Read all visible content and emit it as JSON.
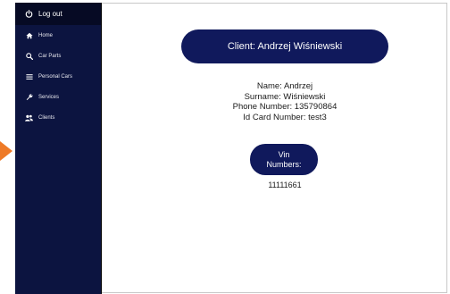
{
  "sidebar": {
    "logout_label": "Log out",
    "items": [
      {
        "label": "Home",
        "icon": "home-icon"
      },
      {
        "label": "Car Parts",
        "icon": "search-icon"
      },
      {
        "label": "Personal Cars",
        "icon": "list-icon"
      },
      {
        "label": "Services",
        "icon": "wrench-icon"
      },
      {
        "label": "Clients",
        "icon": "users-icon"
      }
    ]
  },
  "client": {
    "header": "Client: Andrzej Wiśniewski",
    "name_line": "Name: Andrzej",
    "surname_line": "Surname: Wiśniewski",
    "phone_line": "Phone Number: 135790864",
    "id_card_line": "Id Card Number: test3"
  },
  "vin": {
    "label_line1": "Vin",
    "label_line2": "Numbers:",
    "values": [
      "11111661"
    ]
  },
  "colors": {
    "sidebar_bg": "#0c1440",
    "pill_bg": "#10195c",
    "arrow": "#ee7a27"
  }
}
